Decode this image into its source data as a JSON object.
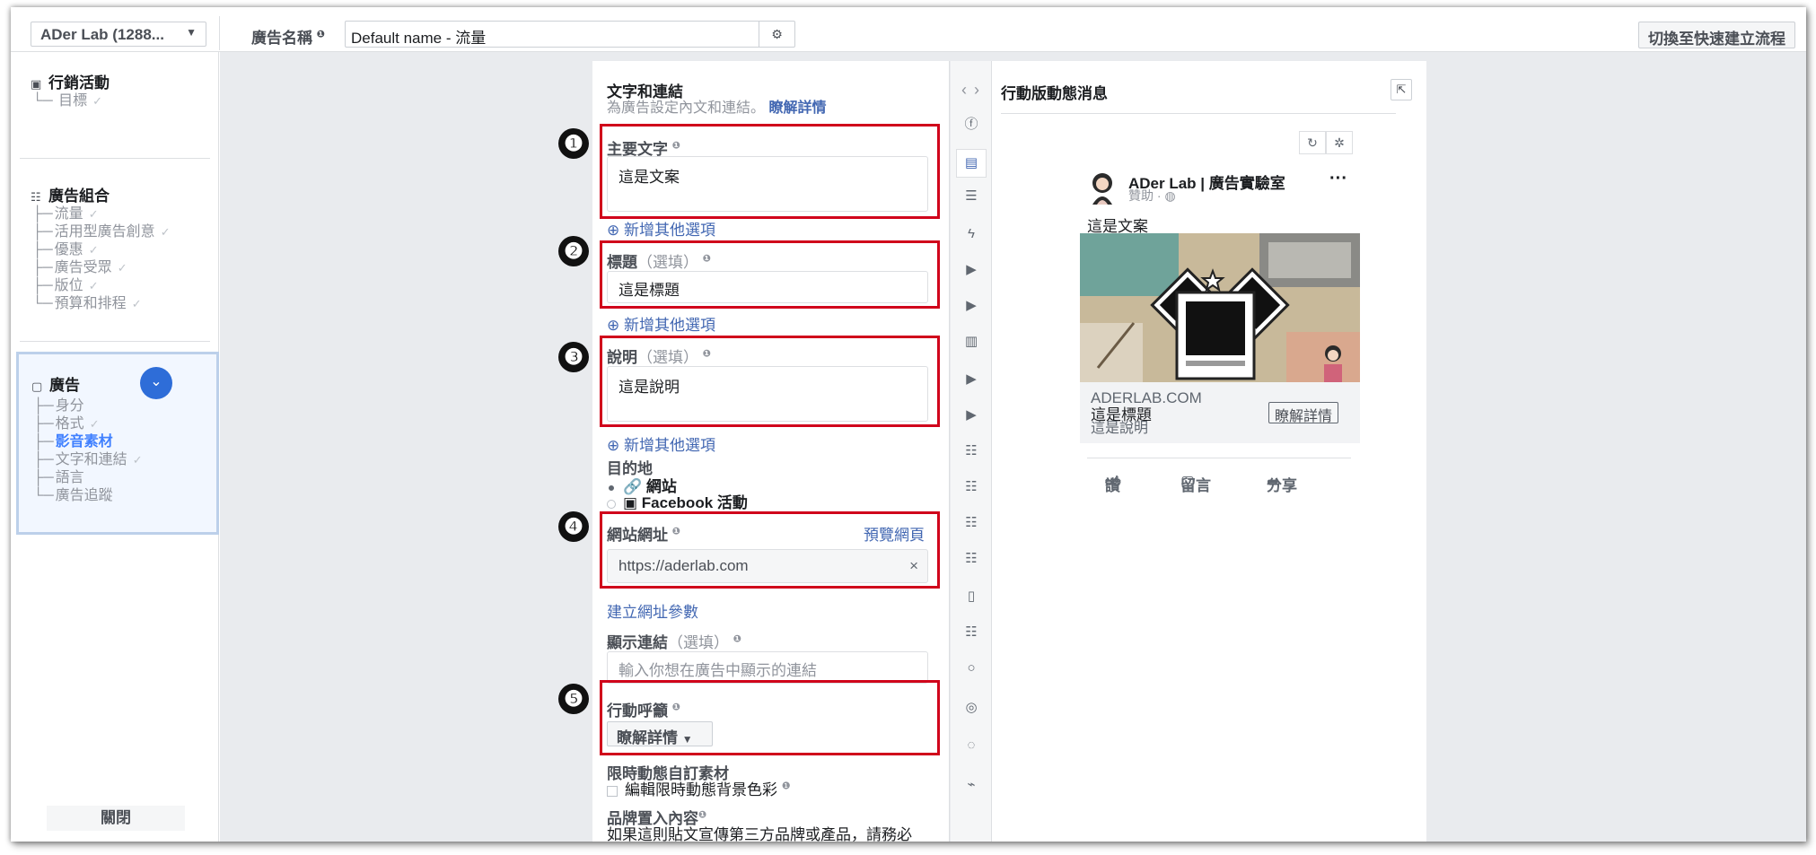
{
  "topbar": {
    "account": "ADer Lab (1288...",
    "ad_name_label": "廣告名稱",
    "ad_name_value": "Default name - 流量",
    "switch_label": "切換至快速建立流程"
  },
  "sidebar": {
    "campaign": {
      "label": "行銷活動",
      "items": [
        "目標"
      ]
    },
    "adset": {
      "label": "廣告組合",
      "items": [
        "流量",
        "活用型廣告創意",
        "優惠",
        "廣告受眾",
        "版位",
        "預算和排程"
      ]
    },
    "ad": {
      "label": "廣告",
      "items": [
        "身分",
        "格式",
        "影音素材",
        "文字和連結",
        "語言",
        "廣告追蹤"
      ],
      "active_item": "影音素材"
    },
    "close_label": "關閉"
  },
  "editor": {
    "title": "文字和連結",
    "subtitle": "為廣告設定內文和連結。",
    "learn_more": "瞭解詳情",
    "primary_text_label": "主要文字",
    "primary_text_value": "這是文案",
    "add_option": "新增其他選項",
    "headline_label": "標題",
    "headline_optional": "（選填）",
    "headline_value": "這是標題",
    "description_label": "說明",
    "description_optional": "（選填）",
    "description_value": "這是說明",
    "destination_label": "目的地",
    "destination_options": [
      "網站",
      "Facebook 活動"
    ],
    "website_url_label": "網站網址",
    "preview_page": "預覽網頁",
    "website_url_value": "https://aderlab.com",
    "build_url_params": "建立網址參數",
    "display_link_label": "顯示連結",
    "display_link_optional": "（選填）",
    "display_link_placeholder": "輸入你想在廣告中顯示的連結",
    "cta_label": "行動呼籲",
    "cta_value": "瞭解詳情",
    "story_label": "限時動態自訂素材",
    "story_checkbox": "編輯限時動態背景色彩",
    "brand_label": "品牌置入內容",
    "brand_text": "如果這則貼文宣傳第三方品牌或產品，請務必"
  },
  "markers": [
    "❶",
    "❷",
    "❸",
    "❹",
    "❺"
  ],
  "preview": {
    "title": "行動版動態消息",
    "page_name": "ADer Lab | 廣告實驗室",
    "sponsored": "贊助 · ",
    "post_text": "這是文案",
    "domain": "ADERLAB.COM",
    "headline": "這是標題",
    "description": "這是說明",
    "cta": "瞭解詳情",
    "like": "讚",
    "comment": "留言",
    "share": "分享"
  },
  "colors": {
    "accent": "#4267b2",
    "highlight": "#d0021b",
    "active_nav": "#4080ff"
  }
}
